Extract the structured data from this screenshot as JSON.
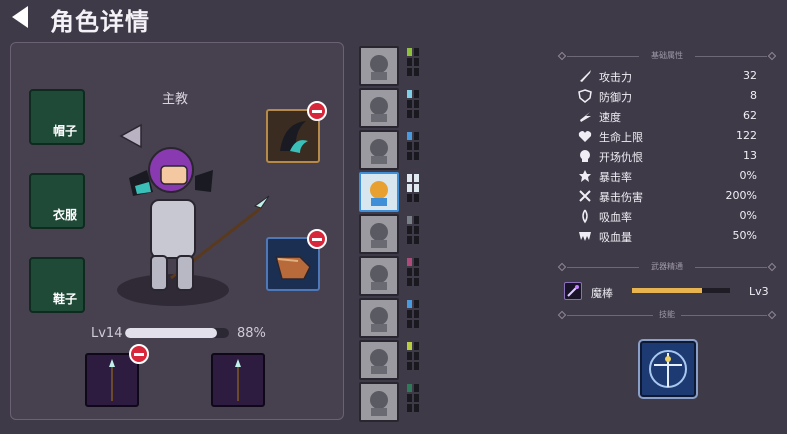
{
  "header": {
    "title": "角色详情"
  },
  "character": {
    "role": "主教",
    "level": "Lv14",
    "xp_percent": "88%",
    "xp_fraction": 0.88,
    "slots": [
      {
        "label": "帽子"
      },
      {
        "label": "衣服"
      },
      {
        "label": "鞋子"
      }
    ]
  },
  "skill_column": {
    "accent_colors": [
      "#8fc23a",
      "#7fd0e6",
      "#4a9ae0",
      "#dfe9f0",
      "#7a8088",
      "#b04a7a",
      "#4a9ae0",
      "#b8d040",
      "#2e7a5a"
    ],
    "active_index": 3
  },
  "stats": {
    "section_basic": "基础属性",
    "rows": [
      {
        "icon": "sword-icon",
        "label": "攻击力",
        "value": "32"
      },
      {
        "icon": "shield-icon",
        "label": "防御力",
        "value": "8"
      },
      {
        "icon": "speed-icon",
        "label": "速度",
        "value": "62"
      },
      {
        "icon": "heart-icon",
        "label": "生命上限",
        "value": "122"
      },
      {
        "icon": "skull-icon",
        "label": "开场仇恨",
        "value": "13"
      },
      {
        "icon": "crit-icon",
        "label": "暴击率",
        "value": "0%"
      },
      {
        "icon": "crit-damage-icon",
        "label": "暴击伤害",
        "value": "200%"
      },
      {
        "icon": "lifesteal-icon",
        "label": "吸血率",
        "value": "0%"
      },
      {
        "icon": "fang-icon",
        "label": "吸血量",
        "value": "50%"
      }
    ],
    "section_weapon": "武器精通",
    "weapon": {
      "name": "魔棒",
      "level": "Lv3",
      "progress_fraction": 0.71
    },
    "section_skill": "技能"
  }
}
